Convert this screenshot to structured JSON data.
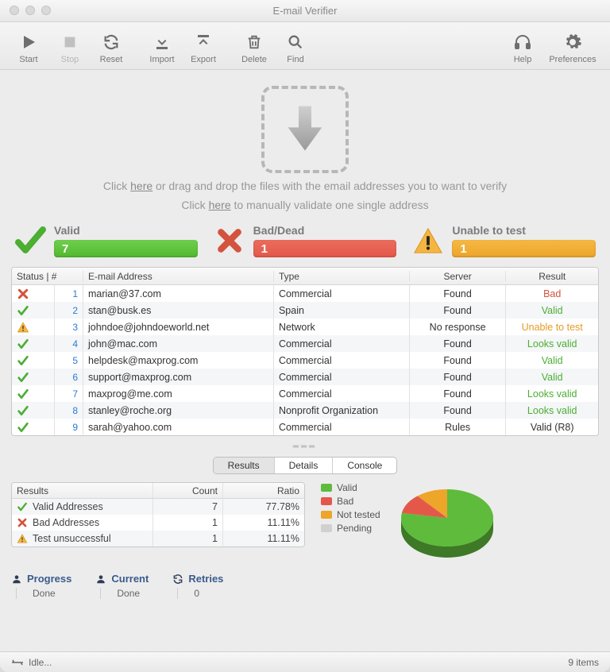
{
  "title": "E-mail Verifier",
  "toolbar": {
    "start": "Start",
    "stop": "Stop",
    "reset": "Reset",
    "import": "Import",
    "export": "Export",
    "delete": "Delete",
    "find": "Find",
    "help": "Help",
    "prefs": "Preferences"
  },
  "dropzone": {
    "l1a": "Click ",
    "l1b": "here",
    "l1c": " or drag and drop the files with the email addresses you to want to verify",
    "l2a": "Click ",
    "l2b": "here",
    "l2c": " to manually validate one single address"
  },
  "summary": {
    "valid_label": "Valid",
    "valid_count": "7",
    "bad_label": "Bad/Dead",
    "bad_count": "1",
    "unable_label": "Unable to test",
    "unable_count": "1"
  },
  "columns": {
    "status": "Status | #",
    "email": "E-mail Address",
    "type": "Type",
    "server": "Server",
    "result": "Result"
  },
  "rows": [
    {
      "n": "1",
      "status": "bad",
      "email": "marian@37.com",
      "type": "Commercial",
      "server": "Found",
      "result": "Bad",
      "rc": "r-red"
    },
    {
      "n": "2",
      "status": "ok",
      "email": "stan@busk.es",
      "type": "Spain",
      "server": "Found",
      "result": "Valid",
      "rc": "r-green"
    },
    {
      "n": "3",
      "status": "warn",
      "email": "johndoe@johndoeworld.net",
      "type": "Network",
      "server": "No response",
      "result": "Unable to test",
      "rc": "r-orange"
    },
    {
      "n": "4",
      "status": "ok",
      "email": "john@mac.com",
      "type": "Commercial",
      "server": "Found",
      "result": "Looks valid",
      "rc": "r-green"
    },
    {
      "n": "5",
      "status": "ok",
      "email": "helpdesk@maxprog.com",
      "type": "Commercial",
      "server": "Found",
      "result": "Valid",
      "rc": "r-green"
    },
    {
      "n": "6",
      "status": "ok",
      "email": "support@maxprog.com",
      "type": "Commercial",
      "server": "Found",
      "result": "Valid",
      "rc": "r-green"
    },
    {
      "n": "7",
      "status": "ok",
      "email": "maxprog@me.com",
      "type": "Commercial",
      "server": "Found",
      "result": "Looks valid",
      "rc": "r-green"
    },
    {
      "n": "8",
      "status": "ok",
      "email": "stanley@roche.org",
      "type": "Nonprofit Organization",
      "server": "Found",
      "result": "Looks valid",
      "rc": "r-green"
    },
    {
      "n": "9",
      "status": "ok",
      "email": "sarah@yahoo.com",
      "type": "Commercial",
      "server": "Rules",
      "result": "Valid (R8)",
      "rc": ""
    }
  ],
  "tabs": {
    "results": "Results",
    "details": "Details",
    "console": "Console"
  },
  "stats": {
    "h_results": "Results",
    "h_count": "Count",
    "h_ratio": "Ratio",
    "rows": [
      {
        "icon": "ok",
        "label": "Valid Addresses",
        "count": "7",
        "ratio": "77.78%"
      },
      {
        "icon": "bad",
        "label": "Bad Addresses",
        "count": "1",
        "ratio": "11.11%"
      },
      {
        "icon": "warn",
        "label": "Test unsuccessful",
        "count": "1",
        "ratio": "11.11%"
      }
    ]
  },
  "legend": {
    "valid": "Valid",
    "bad": "Bad",
    "nottested": "Not tested",
    "pending": "Pending"
  },
  "info": {
    "progress": "Progress",
    "progress_val": "Done",
    "current": "Current",
    "current_val": "Done",
    "retries": "Retries",
    "retries_val": "0"
  },
  "statusbar": {
    "left": "Idle...",
    "right": "9 items"
  },
  "chart_data": {
    "type": "pie",
    "title": "",
    "series": [
      {
        "name": "Valid",
        "value": 77.78,
        "color": "#5fbb3b"
      },
      {
        "name": "Bad",
        "value": 11.11,
        "color": "#e4584a"
      },
      {
        "name": "Not tested",
        "value": 11.11,
        "color": "#eda52a"
      },
      {
        "name": "Pending",
        "value": 0,
        "color": "#d0d0d0"
      }
    ]
  }
}
